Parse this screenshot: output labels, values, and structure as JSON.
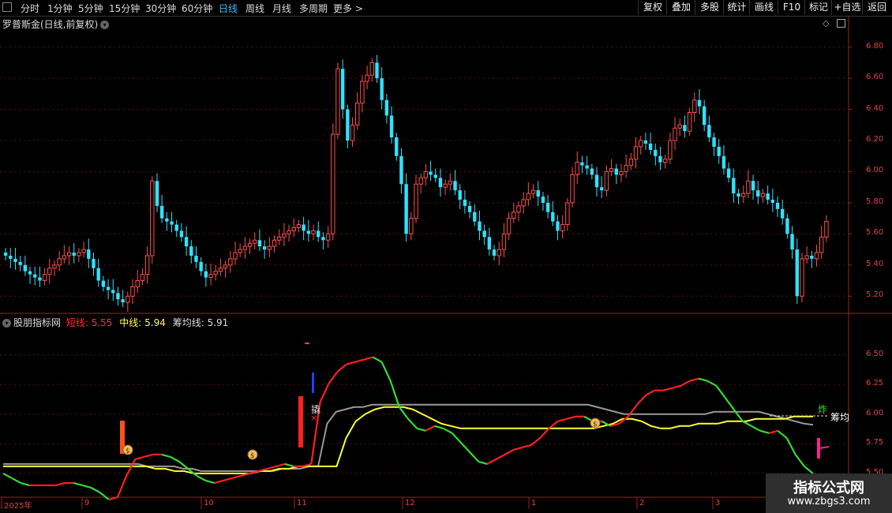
{
  "toolbar": {
    "periods": [
      "分时",
      "1分钟",
      "5分钟",
      "15分钟",
      "30分钟",
      "60分钟",
      "日线",
      "周线",
      "月线",
      "多周期",
      "更多 >"
    ],
    "active_period": "日线",
    "buttons": [
      "复权",
      "叠加",
      "多股",
      "统计",
      "画线",
      "F10",
      "标记",
      "+自选",
      "返回"
    ]
  },
  "main_chart": {
    "title": "罗普斯金(日线,前复权)",
    "y_ticks": [
      "6.80",
      "6.60",
      "6.40",
      "6.20",
      "6.00",
      "5.80",
      "5.60",
      "5.40",
      "5.20"
    ]
  },
  "indicator": {
    "name": "股朋指标网",
    "short_label": "短线:",
    "short_value": "5.55",
    "mid_label": "中线:",
    "mid_value": "5.94",
    "cost_label": "筹均线:",
    "cost_value": "5.91",
    "y_ticks": [
      "6.50",
      "6.25",
      "6.00",
      "5.75",
      "5.50"
    ],
    "marker_qiao": "撬",
    "marker_zha": "炸",
    "cost_text": "筹均"
  },
  "x_axis": {
    "labels": [
      "2025年",
      "9",
      "10",
      "11",
      "12",
      "1",
      "2",
      "3"
    ]
  },
  "watermark": {
    "line1": "指标公式网",
    "line2": "www.zbgs3.com"
  },
  "colors": {
    "up": "#ff4d4d",
    "down": "#2fe3ff",
    "short_line_up": "#ff2020",
    "short_line_down": "#33dd33",
    "mid_line": "#ffff33",
    "cost_line": "#999999",
    "axis": "#d44444",
    "active_tab": "#3fc1ff"
  },
  "chart_data": [
    {
      "type": "candlestick",
      "title": "罗普斯金(日线,前复权)",
      "ylim": [
        5.1,
        6.92
      ],
      "x_labels": [
        "2025年",
        "9",
        "10",
        "11",
        "12",
        "1",
        "2",
        "3"
      ],
      "closes": [
        5.46,
        5.44,
        5.42,
        5.4,
        5.36,
        5.34,
        5.32,
        5.3,
        5.34,
        5.38,
        5.4,
        5.44,
        5.46,
        5.48,
        5.46,
        5.48,
        5.5,
        5.44,
        5.38,
        5.3,
        5.26,
        5.24,
        5.22,
        5.18,
        5.16,
        5.2,
        5.26,
        5.3,
        5.34,
        5.46,
        5.94,
        5.78,
        5.7,
        5.68,
        5.66,
        5.62,
        5.58,
        5.52,
        5.46,
        5.42,
        5.36,
        5.32,
        5.34,
        5.36,
        5.38,
        5.4,
        5.44,
        5.48,
        5.5,
        5.52,
        5.54,
        5.56,
        5.52,
        5.5,
        5.52,
        5.56,
        5.58,
        5.6,
        5.62,
        5.64,
        5.66,
        5.62,
        5.6,
        5.62,
        5.58,
        5.56,
        5.6,
        6.24,
        6.66,
        6.4,
        6.2,
        6.3,
        6.44,
        6.58,
        6.62,
        6.7,
        6.6,
        6.46,
        6.36,
        6.22,
        6.1,
        5.92,
        5.6,
        5.7,
        5.92,
        5.96,
        6.0,
        5.98,
        5.96,
        5.9,
        5.92,
        5.94,
        5.88,
        5.82,
        5.78,
        5.74,
        5.68,
        5.62,
        5.58,
        5.5,
        5.46,
        5.5,
        5.6,
        5.7,
        5.74,
        5.78,
        5.82,
        5.86,
        5.88,
        5.84,
        5.8,
        5.74,
        5.68,
        5.62,
        5.66,
        5.8,
        5.98,
        6.06,
        6.04,
        6.02,
        5.98,
        5.9,
        5.88,
        6.0,
        6.02,
        5.98,
        6.0,
        6.04,
        6.08,
        6.16,
        6.2,
        6.18,
        6.14,
        6.1,
        6.06,
        6.08,
        6.2,
        6.28,
        6.3,
        6.26,
        6.38,
        6.46,
        6.42,
        6.3,
        6.22,
        6.16,
        6.1,
        6.02,
        5.96,
        5.86,
        5.84,
        5.86,
        5.94,
        5.88,
        5.84,
        5.86,
        5.82,
        5.8,
        5.76,
        5.7,
        5.6,
        5.5,
        5.2,
        5.44,
        5.46,
        5.44,
        5.48,
        5.58,
        5.68
      ],
      "opens": [
        5.48,
        5.46,
        5.44,
        5.42,
        5.4,
        5.36,
        5.34,
        5.32,
        5.3,
        5.34,
        5.38,
        5.4,
        5.44,
        5.46,
        5.48,
        5.46,
        5.48,
        5.5,
        5.44,
        5.38,
        5.3,
        5.26,
        5.24,
        5.22,
        5.18,
        5.16,
        5.2,
        5.26,
        5.3,
        5.34,
        5.46,
        5.94,
        5.78,
        5.7,
        5.68,
        5.66,
        5.62,
        5.58,
        5.52,
        5.46,
        5.42,
        5.36,
        5.32,
        5.34,
        5.36,
        5.38,
        5.4,
        5.44,
        5.48,
        5.5,
        5.52,
        5.54,
        5.56,
        5.52,
        5.5,
        5.52,
        5.56,
        5.58,
        5.6,
        5.62,
        5.64,
        5.66,
        5.62,
        5.6,
        5.62,
        5.58,
        5.56,
        5.6,
        6.24,
        6.66,
        6.4,
        6.2,
        6.3,
        6.44,
        6.58,
        6.62,
        6.7,
        6.6,
        6.46,
        6.36,
        6.22,
        6.1,
        5.92,
        5.6,
        5.7,
        5.92,
        5.96,
        6.0,
        5.98,
        5.96,
        5.9,
        5.92,
        5.94,
        5.88,
        5.82,
        5.78,
        5.74,
        5.68,
        5.62,
        5.58,
        5.5,
        5.46,
        5.5,
        5.6,
        5.7,
        5.74,
        5.78,
        5.82,
        5.86,
        5.88,
        5.84,
        5.8,
        5.74,
        5.68,
        5.62,
        5.66,
        5.8,
        5.98,
        6.06,
        6.04,
        6.02,
        5.98,
        5.9,
        5.88,
        6.0,
        6.02,
        5.98,
        6.0,
        6.04,
        6.08,
        6.16,
        6.2,
        6.18,
        6.14,
        6.1,
        6.06,
        6.08,
        6.2,
        6.28,
        6.3,
        6.26,
        6.38,
        6.46,
        6.42,
        6.3,
        6.22,
        6.16,
        6.1,
        6.02,
        5.96,
        5.86,
        5.84,
        5.86,
        5.94,
        5.88,
        5.84,
        5.86,
        5.82,
        5.8,
        5.76,
        5.7,
        5.6,
        5.5,
        5.2,
        5.44,
        5.46,
        5.44,
        5.48,
        5.58
      ]
    },
    {
      "type": "line",
      "title": "股朋指标网",
      "ylim": [
        5.3,
        6.75
      ],
      "series": [
        {
          "name": "短线",
          "values": [
            5.5,
            5.46,
            5.42,
            5.4,
            5.4,
            5.4,
            5.4,
            5.42,
            5.42,
            5.4,
            5.38,
            5.34,
            5.28,
            5.3,
            5.48,
            5.62,
            5.64,
            5.66,
            5.66,
            5.64,
            5.6,
            5.54,
            5.48,
            5.44,
            5.42,
            5.44,
            5.46,
            5.48,
            5.5,
            5.52,
            5.54,
            5.56,
            5.58,
            5.56,
            5.56,
            5.58,
            6.1,
            6.26,
            6.36,
            6.42,
            6.44,
            6.46,
            6.48,
            6.44,
            6.28,
            6.06,
            5.96,
            5.88,
            5.86,
            5.9,
            5.88,
            5.84,
            5.76,
            5.68,
            5.6,
            5.58,
            5.62,
            5.66,
            5.7,
            5.72,
            5.74,
            5.8,
            5.88,
            5.94,
            5.96,
            5.98,
            5.98,
            5.94,
            5.94,
            5.9,
            5.92,
            5.98,
            6.08,
            6.16,
            6.2,
            6.2,
            6.22,
            6.24,
            6.28,
            6.3,
            6.28,
            6.24,
            6.14,
            6.04,
            5.94,
            5.9,
            5.86,
            5.84,
            5.86,
            5.8,
            5.66,
            5.56,
            5.5
          ]
        },
        {
          "name": "中线",
          "values": [
            5.56,
            5.56,
            5.56,
            5.56,
            5.56,
            5.56,
            5.56,
            5.56,
            5.56,
            5.56,
            5.56,
            5.56,
            5.56,
            5.56,
            5.56,
            5.56,
            5.54,
            5.54,
            5.52,
            5.52,
            5.5,
            5.5,
            5.5,
            5.5,
            5.5,
            5.5,
            5.5,
            5.52,
            5.52,
            5.54,
            5.54,
            5.56,
            5.56,
            5.56,
            5.56,
            5.56,
            5.8,
            5.94,
            6.0,
            6.04,
            6.06,
            6.06,
            6.06,
            6.04,
            6.0,
            5.96,
            5.92,
            5.9,
            5.88,
            5.88,
            5.88,
            5.88,
            5.88,
            5.88,
            5.88,
            5.88,
            5.88,
            5.88,
            5.88,
            5.88,
            5.88,
            5.88,
            5.88,
            5.9,
            5.92,
            5.96,
            5.96,
            5.94,
            5.9,
            5.88,
            5.88,
            5.9,
            5.9,
            5.92,
            5.92,
            5.92,
            5.94,
            5.94,
            5.94,
            5.96,
            5.96,
            5.96,
            5.96,
            5.98,
            5.98,
            5.98
          ]
        },
        {
          "name": "筹均线",
          "values": [
            5.58,
            5.58,
            5.58,
            5.58,
            5.58,
            5.58,
            5.58,
            5.58,
            5.58,
            5.58,
            5.58,
            5.58,
            5.58,
            5.58,
            5.58,
            5.58,
            5.56,
            5.56,
            5.56,
            5.56,
            5.54,
            5.54,
            5.52,
            5.52,
            5.52,
            5.52,
            5.52,
            5.52,
            5.52,
            5.52,
            5.52,
            5.54,
            5.54,
            5.54,
            5.56,
            5.56,
            5.92,
            6.02,
            6.04,
            6.06,
            6.06,
            6.08,
            6.08,
            6.08,
            6.08,
            6.08,
            6.08,
            6.08,
            6.08,
            6.08,
            6.08,
            6.08,
            6.08,
            6.08,
            6.08,
            6.08,
            6.08,
            6.08,
            6.08,
            6.08,
            6.08,
            6.08,
            6.08,
            6.08,
            6.08,
            6.08,
            6.06,
            6.04,
            6.02,
            6.0,
            6.0,
            6.0,
            6.0,
            6.0,
            6.0,
            6.0,
            6.0,
            6.0,
            6.0,
            6.02,
            6.02,
            6.02,
            6.02,
            6.02,
            6.02,
            6.0,
            5.98,
            5.96,
            5.94,
            5.92,
            5.91
          ]
        }
      ]
    }
  ]
}
